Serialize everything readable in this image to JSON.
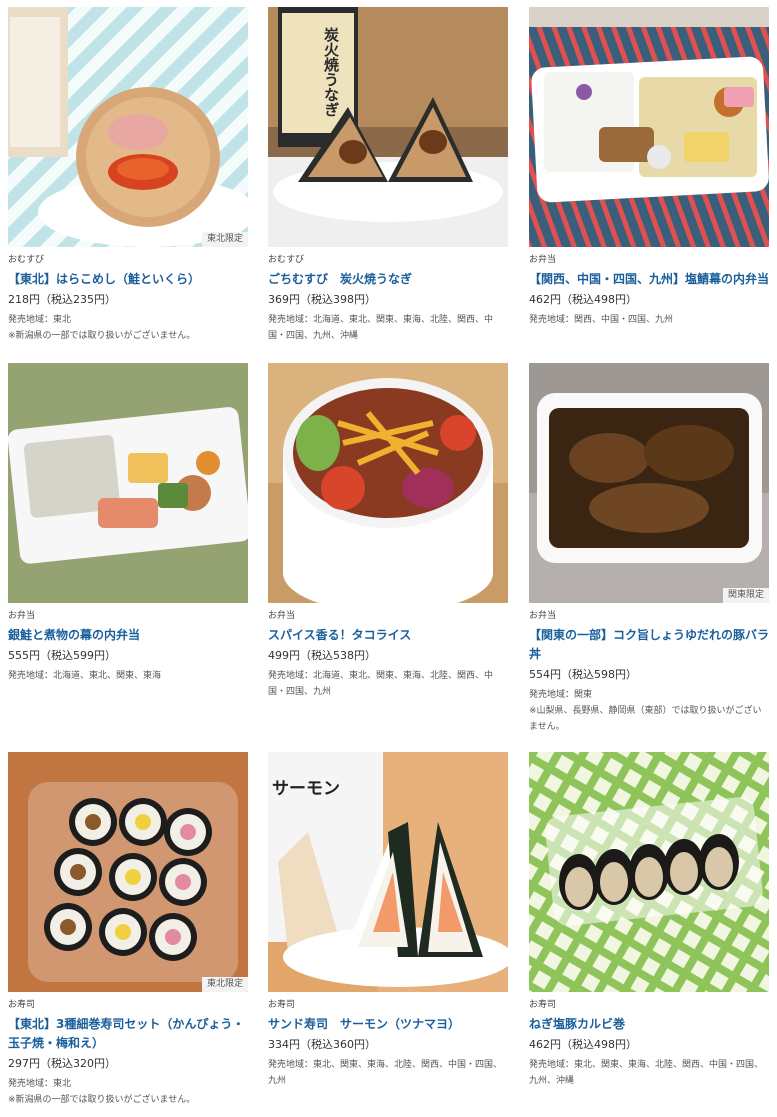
{
  "products": [
    {
      "category": "おむすび",
      "title": "【東北】はらこめし（鮭といくら）",
      "price": "218円（税込235円）",
      "area": "発売地域：東北",
      "note": "※新潟県の一部では取り扱いがございません。",
      "badge": "東北限定"
    },
    {
      "category": "おむすび",
      "title": "ごちむすび　炭火焼うなぎ",
      "price": "369円（税込398円）",
      "area": "発売地域：北海道、東北、関東、東海、北陸、関西、中国・四国、九州、沖縄",
      "note": "",
      "badge": "",
      "package_text": "炭火焼うなぎ"
    },
    {
      "category": "お弁当",
      "title": "【関西、中国・四国、九州】塩鯖幕の内弁当",
      "price": "462円（税込498円）",
      "area": "発売地域：関西、中国・四国、九州",
      "note": "",
      "badge": ""
    },
    {
      "category": "お弁当",
      "title": "銀鮭と煮物の幕の内弁当",
      "price": "555円（税込599円）",
      "area": "発売地域：北海道、東北、関東、東海",
      "note": "",
      "badge": ""
    },
    {
      "category": "お弁当",
      "title": "スパイス香る！タコライス",
      "price": "499円（税込538円）",
      "area": "発売地域：北海道、東北、関東、東海、北陸、関西、中国・四国、九州",
      "note": "",
      "badge": ""
    },
    {
      "category": "お弁当",
      "title": "【関東の一部】コク旨しょうゆだれの豚バラ丼",
      "price": "554円（税込598円）",
      "area": "発売地域：関東",
      "note": "※山梨県、長野県、静岡県（東部）では取り扱いがございません。",
      "badge": "関東限定"
    },
    {
      "category": "お寿司",
      "title": "【東北】3種細巻寿司セット（かんぴょう・玉子焼・梅和え）",
      "price": "297円（税込320円）",
      "area": "発売地域：東北",
      "note": "※新潟県の一部では取り扱いがございません。",
      "badge": "東北限定"
    },
    {
      "category": "お寿司",
      "title": "サンド寿司　サーモン（ツナマヨ）",
      "price": "334円（税込360円）",
      "area": "発売地域：東北、関東、東海、北陸、関西、中国・四国、九州",
      "note": "",
      "badge": "",
      "package_text": "サーモン"
    },
    {
      "category": "お寿司",
      "title": "ねぎ塩豚カルビ巻",
      "price": "462円（税込498円）",
      "area": "発売地域：東北、関東、東海、北陸、関西、中国・四国、九州、沖縄",
      "note": "",
      "badge": ""
    }
  ],
  "colors": {
    "title": "#1a5f9c",
    "text": "#333333",
    "badge_bg": "#f3f3f3"
  }
}
